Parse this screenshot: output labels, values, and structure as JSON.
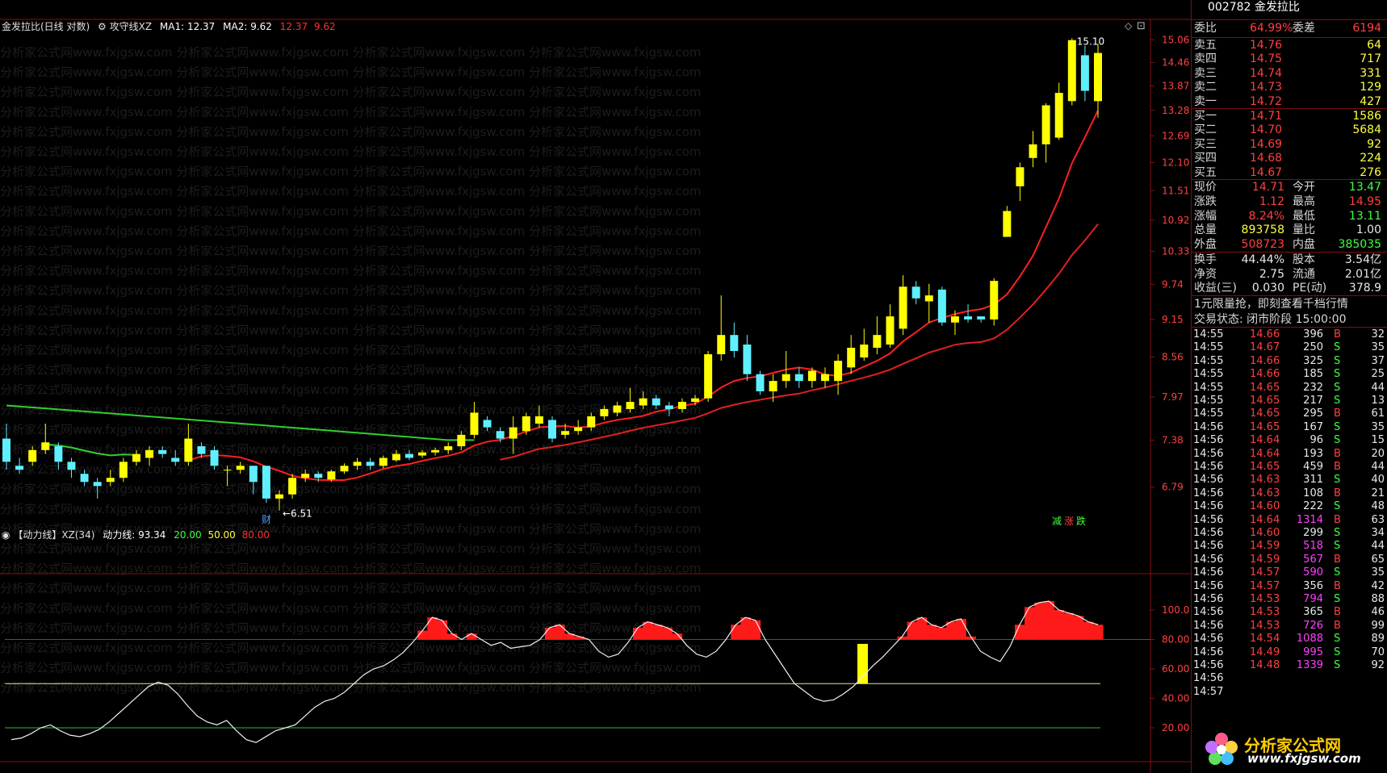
{
  "main_legend": {
    "symbol": "金发拉比(日线 对数)",
    "indicator": "攻守线XZ",
    "ma1_label": "MA1: 12.37",
    "ma2_label": "MA2: 9.62",
    "extra1": "12.37",
    "extra2": "9.62"
  },
  "sub_legend": {
    "name": "【动力线】XZ(34)",
    "value": "动力线: 93.34",
    "l1": "20.00",
    "l2": "50.00",
    "l3": "80.00"
  },
  "watermark": "分析家公式网www.fxjgsw.com",
  "annotations": {
    "high": "15.10",
    "low": "6.51",
    "cai": "财",
    "jian": "减",
    "zhang": "涨",
    "die": "跌"
  },
  "price_axis": [
    "15.06",
    "14.46",
    "13.87",
    "13.28",
    "12.69",
    "12.10",
    "11.51",
    "10.92",
    "10.33",
    "9.74",
    "9.15",
    "8.56",
    "7.97",
    "7.38",
    "6.79"
  ],
  "sub_axis": [
    "100.0",
    "80.00",
    "60.00",
    "40.00",
    "20.00"
  ],
  "colors": {
    "up": "#ffff00",
    "down": "#5ef0ff",
    "ma1": "#ff2020",
    "ma2": "#e02020",
    "green_line": "#30d030",
    "bg": "#000000"
  },
  "chart_data": {
    "type": "candlestick",
    "candles": [
      {
        "o": 7.4,
        "c": 7.1,
        "h": 7.6,
        "l": 7.0
      },
      {
        "o": 7.05,
        "c": 7.0,
        "h": 7.15,
        "l": 6.95
      },
      {
        "o": 7.1,
        "c": 7.25,
        "h": 7.3,
        "l": 7.05
      },
      {
        "o": 7.25,
        "c": 7.35,
        "h": 7.6,
        "l": 7.2
      },
      {
        "o": 7.3,
        "c": 7.1,
        "h": 7.35,
        "l": 7.0
      },
      {
        "o": 7.1,
        "c": 7.0,
        "h": 7.15,
        "l": 6.9
      },
      {
        "o": 6.95,
        "c": 6.85,
        "h": 7.0,
        "l": 6.8
      },
      {
        "o": 6.85,
        "c": 6.8,
        "h": 6.9,
        "l": 6.65
      },
      {
        "o": 6.85,
        "c": 6.9,
        "h": 7.0,
        "l": 6.8
      },
      {
        "o": 6.9,
        "c": 7.1,
        "h": 7.15,
        "l": 6.85
      },
      {
        "o": 7.1,
        "c": 7.2,
        "h": 7.25,
        "l": 7.05
      },
      {
        "o": 7.15,
        "c": 7.25,
        "h": 7.3,
        "l": 7.05
      },
      {
        "o": 7.25,
        "c": 7.2,
        "h": 7.3,
        "l": 7.15
      },
      {
        "o": 7.15,
        "c": 7.1,
        "h": 7.25,
        "l": 7.05
      },
      {
        "o": 7.1,
        "c": 7.4,
        "h": 7.6,
        "l": 7.05
      },
      {
        "o": 7.3,
        "c": 7.2,
        "h": 7.35,
        "l": 7.15
      },
      {
        "o": 7.25,
        "c": 7.05,
        "h": 7.3,
        "l": 7.0
      },
      {
        "o": 7.0,
        "c": 7.0,
        "h": 7.05,
        "l": 6.8
      },
      {
        "o": 7.0,
        "c": 7.05,
        "h": 7.1,
        "l": 6.95
      },
      {
        "o": 7.05,
        "c": 6.85,
        "h": 7.05,
        "l": 6.7
      },
      {
        "o": 7.05,
        "c": 6.65,
        "h": 7.05,
        "l": 6.6
      },
      {
        "o": 6.65,
        "c": 6.7,
        "h": 6.75,
        "l": 6.51
      },
      {
        "o": 6.7,
        "c": 6.9,
        "h": 6.95,
        "l": 6.65
      },
      {
        "o": 6.9,
        "c": 6.95,
        "h": 7.0,
        "l": 6.85
      },
      {
        "o": 6.95,
        "c": 6.9,
        "h": 6.98,
        "l": 6.85
      },
      {
        "o": 6.88,
        "c": 6.98,
        "h": 7.0,
        "l": 6.85
      },
      {
        "o": 6.98,
        "c": 7.05,
        "h": 7.08,
        "l": 6.95
      },
      {
        "o": 7.05,
        "c": 7.1,
        "h": 7.15,
        "l": 7.0
      },
      {
        "o": 7.1,
        "c": 7.05,
        "h": 7.15,
        "l": 7.0
      },
      {
        "o": 7.05,
        "c": 7.15,
        "h": 7.18,
        "l": 7.02
      },
      {
        "o": 7.12,
        "c": 7.2,
        "h": 7.25,
        "l": 7.1
      },
      {
        "o": 7.2,
        "c": 7.15,
        "h": 7.25,
        "l": 7.12
      },
      {
        "o": 7.18,
        "c": 7.22,
        "h": 7.25,
        "l": 7.15
      },
      {
        "o": 7.22,
        "c": 7.25,
        "h": 7.28,
        "l": 7.18
      },
      {
        "o": 7.25,
        "c": 7.3,
        "h": 7.35,
        "l": 7.2
      },
      {
        "o": 7.3,
        "c": 7.45,
        "h": 7.5,
        "l": 7.25
      },
      {
        "o": 7.45,
        "c": 7.75,
        "h": 7.9,
        "l": 7.4
      },
      {
        "o": 7.65,
        "c": 7.55,
        "h": 7.7,
        "l": 7.5
      },
      {
        "o": 7.5,
        "c": 7.4,
        "h": 7.55,
        "l": 7.35
      },
      {
        "o": 7.4,
        "c": 7.55,
        "h": 7.7,
        "l": 7.2
      },
      {
        "o": 7.5,
        "c": 7.7,
        "h": 7.75,
        "l": 7.45
      },
      {
        "o": 7.6,
        "c": 7.7,
        "h": 7.85,
        "l": 7.55
      },
      {
        "o": 7.65,
        "c": 7.4,
        "h": 7.7,
        "l": 7.35
      },
      {
        "o": 7.45,
        "c": 7.5,
        "h": 7.6,
        "l": 7.4
      },
      {
        "o": 7.5,
        "c": 7.55,
        "h": 7.65,
        "l": 7.45
      },
      {
        "o": 7.55,
        "c": 7.7,
        "h": 7.75,
        "l": 7.5
      },
      {
        "o": 7.7,
        "c": 7.8,
        "h": 7.85,
        "l": 7.65
      },
      {
        "o": 7.75,
        "c": 7.85,
        "h": 7.9,
        "l": 7.7
      },
      {
        "o": 7.8,
        "c": 7.9,
        "h": 8.1,
        "l": 7.75
      },
      {
        "o": 7.85,
        "c": 7.95,
        "h": 8.05,
        "l": 7.8
      },
      {
        "o": 7.95,
        "c": 7.85,
        "h": 8.0,
        "l": 7.8
      },
      {
        "o": 7.85,
        "c": 7.8,
        "h": 7.9,
        "l": 7.7
      },
      {
        "o": 7.8,
        "c": 7.9,
        "h": 7.95,
        "l": 7.75
      },
      {
        "o": 7.9,
        "c": 7.95,
        "h": 8.0,
        "l": 7.85
      },
      {
        "o": 7.95,
        "c": 8.6,
        "h": 8.65,
        "l": 7.9
      },
      {
        "o": 8.6,
        "c": 8.9,
        "h": 9.55,
        "l": 8.5
      },
      {
        "o": 8.9,
        "c": 8.65,
        "h": 9.1,
        "l": 8.55
      },
      {
        "o": 8.75,
        "c": 8.3,
        "h": 8.9,
        "l": 8.2
      },
      {
        "o": 8.3,
        "c": 8.05,
        "h": 8.35,
        "l": 8.0
      },
      {
        "o": 8.05,
        "c": 8.2,
        "h": 8.3,
        "l": 7.9
      },
      {
        "o": 8.2,
        "c": 8.3,
        "h": 8.65,
        "l": 8.1
      },
      {
        "o": 8.3,
        "c": 8.2,
        "h": 8.4,
        "l": 8.1
      },
      {
        "o": 8.2,
        "c": 8.35,
        "h": 8.4,
        "l": 8.1
      },
      {
        "o": 8.2,
        "c": 8.3,
        "h": 8.4,
        "l": 8.1
      },
      {
        "o": 8.2,
        "c": 8.5,
        "h": 8.6,
        "l": 8.0
      },
      {
        "o": 8.4,
        "c": 8.7,
        "h": 8.9,
        "l": 8.3
      },
      {
        "o": 8.55,
        "c": 8.75,
        "h": 9.0,
        "l": 8.5
      },
      {
        "o": 8.7,
        "c": 8.9,
        "h": 9.2,
        "l": 8.6
      },
      {
        "o": 8.75,
        "c": 9.2,
        "h": 9.4,
        "l": 8.7
      },
      {
        "o": 9.0,
        "c": 9.7,
        "h": 9.9,
        "l": 8.9
      },
      {
        "o": 9.7,
        "c": 9.5,
        "h": 9.8,
        "l": 9.4
      },
      {
        "o": 9.45,
        "c": 9.55,
        "h": 9.75,
        "l": 9.1
      },
      {
        "o": 9.65,
        "c": 9.1,
        "h": 9.7,
        "l": 9.05
      },
      {
        "o": 9.1,
        "c": 9.2,
        "h": 9.3,
        "l": 8.9
      },
      {
        "o": 9.2,
        "c": 9.15,
        "h": 9.4,
        "l": 9.1
      },
      {
        "o": 9.2,
        "c": 9.15,
        "h": 9.2,
        "l": 9.1
      },
      {
        "o": 9.15,
        "c": 9.8,
        "h": 9.85,
        "l": 9.05
      },
      {
        "o": 10.6,
        "c": 11.1,
        "h": 11.2,
        "l": 10.6
      },
      {
        "o": 11.6,
        "c": 12.0,
        "h": 12.1,
        "l": 11.3
      },
      {
        "o": 12.2,
        "c": 12.5,
        "h": 12.8,
        "l": 12.0
      },
      {
        "o": 12.5,
        "c": 13.4,
        "h": 13.45,
        "l": 12.1
      },
      {
        "o": 12.65,
        "c": 13.7,
        "h": 13.95,
        "l": 12.6
      },
      {
        "o": 13.5,
        "c": 15.05,
        "h": 15.1,
        "l": 13.4
      },
      {
        "o": 14.65,
        "c": 13.75,
        "h": 14.9,
        "l": 13.5
      },
      {
        "o": 13.5,
        "c": 14.71,
        "h": 14.95,
        "l": 13.11
      }
    ],
    "ma1": [],
    "ma2": [],
    "force_line": [
      12,
      13,
      16,
      20,
      22,
      18,
      15,
      14,
      16,
      19,
      24,
      30,
      36,
      42,
      48,
      51,
      49,
      43,
      35,
      28,
      24,
      22,
      25,
      18,
      12,
      10,
      14,
      18,
      20,
      22,
      28,
      34,
      38,
      40,
      44,
      50,
      56,
      60,
      62,
      66,
      71,
      78,
      86,
      95,
      93,
      84,
      80,
      84,
      80,
      76,
      78,
      74,
      75,
      76,
      80,
      88,
      90,
      84,
      82,
      80,
      72,
      68,
      70,
      78,
      88,
      92,
      90,
      88,
      84,
      76,
      70,
      68,
      72,
      80,
      90,
      95,
      93,
      80,
      70,
      60,
      50,
      45,
      40,
      38,
      39,
      43,
      48,
      55,
      62,
      68,
      75,
      82,
      92,
      95,
      90,
      88,
      92,
      94,
      82,
      72,
      68,
      65,
      75,
      90,
      102,
      105,
      106,
      100,
      98,
      96,
      92,
      90
    ]
  },
  "panel": {
    "top_code": "002782 金发拉比",
    "weibi": {
      "label": "委比",
      "pct": "64.99%",
      "label2": "委差",
      "val": "6194"
    },
    "asks": [
      {
        "label": "卖五",
        "price": "14.76",
        "vol": "64"
      },
      {
        "label": "卖四",
        "price": "14.75",
        "vol": "717"
      },
      {
        "label": "卖三",
        "price": "14.74",
        "vol": "331"
      },
      {
        "label": "卖二",
        "price": "14.73",
        "vol": "129"
      },
      {
        "label": "卖一",
        "price": "14.72",
        "vol": "427"
      }
    ],
    "bids": [
      {
        "label": "买一",
        "price": "14.71",
        "vol": "1586"
      },
      {
        "label": "买二",
        "price": "14.70",
        "vol": "5684"
      },
      {
        "label": "买三",
        "price": "14.69",
        "vol": "92"
      },
      {
        "label": "买四",
        "price": "14.68",
        "vol": "224"
      },
      {
        "label": "买五",
        "price": "14.67",
        "vol": "276"
      }
    ],
    "stats": [
      {
        "l1": "现价",
        "v1": "14.71",
        "c1": "red",
        "l2": "今开",
        "v2": "13.47",
        "c2": "green"
      },
      {
        "l1": "涨跌",
        "v1": "1.12",
        "c1": "red",
        "l2": "最高",
        "v2": "14.95",
        "c2": "red"
      },
      {
        "l1": "涨幅",
        "v1": "8.24%",
        "c1": "red",
        "l2": "最低",
        "v2": "13.11",
        "c2": "green"
      },
      {
        "l1": "总量",
        "v1": "893758",
        "c1": "yel",
        "l2": "量比",
        "v2": "1.00",
        "c2": "wht"
      },
      {
        "l1": "外盘",
        "v1": "508723",
        "c1": "red",
        "l2": "内盘",
        "v2": "385035",
        "c2": "green"
      }
    ],
    "stats2": [
      {
        "l1": "换手",
        "v1": "44.44%",
        "l2": "股本",
        "v2": "3.54亿"
      },
      {
        "l1": "净资",
        "v1": "2.75",
        "l2": "流通",
        "v2": "2.01亿"
      },
      {
        "l1": "收益(三)",
        "v1": "0.030",
        "l2": "PE(动)",
        "v2": "378.9"
      }
    ],
    "promo": "1元限量抢，即刻查看千档行情",
    "trade_status": "交易状态: 闭市阶段 15:00:00",
    "ticks": [
      {
        "t": "14:55",
        "p": "14.66",
        "v": "396",
        "s": "B",
        "n": "32"
      },
      {
        "t": "14:55",
        "p": "14.67",
        "v": "250",
        "s": "S",
        "n": "35"
      },
      {
        "t": "14:55",
        "p": "14.66",
        "v": "325",
        "s": "S",
        "n": "37"
      },
      {
        "t": "14:55",
        "p": "14.66",
        "v": "185",
        "s": "S",
        "n": "25"
      },
      {
        "t": "14:55",
        "p": "14.65",
        "v": "232",
        "s": "S",
        "n": "44"
      },
      {
        "t": "14:55",
        "p": "14.65",
        "v": "217",
        "s": "S",
        "n": "13"
      },
      {
        "t": "14:55",
        "p": "14.65",
        "v": "295",
        "s": "B",
        "n": "61"
      },
      {
        "t": "14:56",
        "p": "14.65",
        "v": "167",
        "s": "S",
        "n": "35"
      },
      {
        "t": "14:56",
        "p": "14.64",
        "v": "96",
        "s": "S",
        "n": "15"
      },
      {
        "t": "14:56",
        "p": "14.64",
        "v": "193",
        "s": "B",
        "n": "20"
      },
      {
        "t": "14:56",
        "p": "14.65",
        "v": "459",
        "s": "B",
        "n": "44"
      },
      {
        "t": "14:56",
        "p": "14.63",
        "v": "311",
        "s": "S",
        "n": "40"
      },
      {
        "t": "14:56",
        "p": "14.63",
        "v": "108",
        "s": "B",
        "n": "21"
      },
      {
        "t": "14:56",
        "p": "14.60",
        "v": "222",
        "s": "S",
        "n": "48"
      },
      {
        "t": "14:56",
        "p": "14.64",
        "v": "1314",
        "s": "B",
        "n": "63"
      },
      {
        "t": "14:56",
        "p": "14.60",
        "v": "299",
        "s": "S",
        "n": "34"
      },
      {
        "t": "14:56",
        "p": "14.59",
        "v": "518",
        "s": "S",
        "n": "44"
      },
      {
        "t": "14:56",
        "p": "14.59",
        "v": "567",
        "s": "B",
        "n": "65"
      },
      {
        "t": "14:56",
        "p": "14.57",
        "v": "590",
        "s": "S",
        "n": "35"
      },
      {
        "t": "14:56",
        "p": "14.57",
        "v": "356",
        "s": "B",
        "n": "42"
      },
      {
        "t": "14:56",
        "p": "14.53",
        "v": "794",
        "s": "S",
        "n": "88"
      },
      {
        "t": "14:56",
        "p": "14.53",
        "v": "365",
        "s": "B",
        "n": "46"
      },
      {
        "t": "14:56",
        "p": "14.53",
        "v": "726",
        "s": "B",
        "n": "99"
      },
      {
        "t": "14:56",
        "p": "14.54",
        "v": "1088",
        "s": "S",
        "n": "89"
      },
      {
        "t": "14:56",
        "p": "14.49",
        "v": "995",
        "s": "S",
        "n": "70"
      },
      {
        "t": "14:56",
        "p": "14.48",
        "v": "1339",
        "s": "S",
        "n": "92"
      },
      {
        "t": "14:56",
        "p": "",
        "v": "",
        "s": "",
        "n": ""
      },
      {
        "t": "14:57",
        "p": "",
        "v": "",
        "s": "",
        "n": ""
      }
    ],
    "logo_title": "分析家公式网",
    "logo_url": "www.fxjgsw.com"
  }
}
